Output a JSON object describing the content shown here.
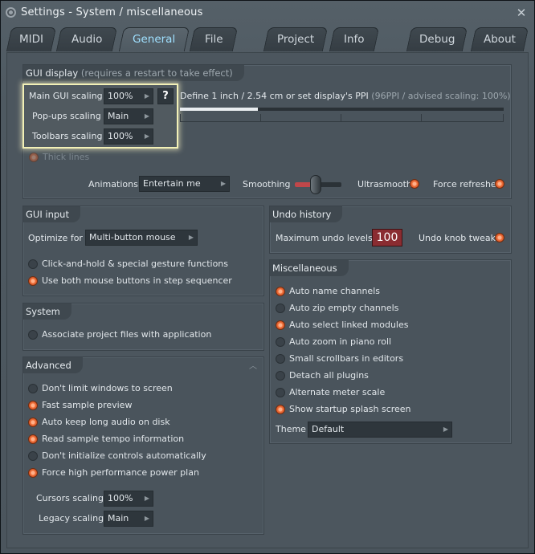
{
  "window": {
    "title": "Settings - System / miscellaneous",
    "close_glyph": "✕"
  },
  "tabs": [
    {
      "label": "MIDI"
    },
    {
      "label": "Audio"
    },
    {
      "label": "General",
      "active": true
    },
    {
      "label": "File"
    },
    {
      "label": "Project"
    },
    {
      "label": "Info"
    },
    {
      "label": "Debug"
    },
    {
      "label": "About"
    }
  ],
  "gui_display": {
    "title": "GUI display",
    "subtitle": "(requires a restart to take effect)",
    "main_scaling_label": "Main GUI scaling",
    "main_scaling_value": "100%",
    "help_label": "?",
    "popups_label": "Pop-ups scaling",
    "popups_value": "Main",
    "toolbars_label": "Toolbars scaling",
    "toolbars_value": "100%",
    "define_label": "Define 1 inch / 2.54 cm or set display's PPI",
    "define_hint": "(96PPI / advised scaling: 100%)",
    "ppi_level": 0.24,
    "thick_lines_label": "Thick lines",
    "animations_label": "Animations",
    "animations_value": "Entertain me",
    "smoothing_label": "Smoothing",
    "smoothing_level": 0.45,
    "ultrasmooth_label": "Ultrasmooth",
    "force_refreshes_label": "Force refreshes"
  },
  "gui_input": {
    "title": "GUI input",
    "optimize_label": "Optimize for",
    "optimize_value": "Multi-button mouse",
    "options": [
      {
        "label": "Click-and-hold & special gesture functions",
        "checked": false
      },
      {
        "label": "Use both mouse buttons in step sequencer",
        "checked": true
      }
    ]
  },
  "system": {
    "title": "System",
    "options": [
      {
        "label": "Associate project files with application",
        "checked": false
      }
    ]
  },
  "advanced": {
    "title": "Advanced",
    "collapse_glyph": "︿",
    "options": [
      {
        "label": "Don't limit windows to screen",
        "checked": false
      },
      {
        "label": "Fast sample preview",
        "checked": true
      },
      {
        "label": "Auto keep long audio on disk",
        "checked": true
      },
      {
        "label": "Read sample tempo information",
        "checked": true
      },
      {
        "label": "Don't initialize controls automatically",
        "checked": false
      },
      {
        "label": "Force high performance power plan",
        "checked": true
      }
    ],
    "cursors_label": "Cursors scaling",
    "cursors_value": "100%",
    "legacy_label": "Legacy scaling",
    "legacy_value": "Main"
  },
  "undo_history": {
    "title": "Undo history",
    "max_label": "Maximum undo levels",
    "max_value": "100",
    "knob_tweaks_label": "Undo knob tweaks"
  },
  "misc": {
    "title": "Miscellaneous",
    "options": [
      {
        "label": "Auto name channels",
        "checked": true
      },
      {
        "label": "Auto zip empty channels",
        "checked": false
      },
      {
        "label": "Auto select linked modules",
        "checked": true
      },
      {
        "label": "Auto zoom in piano roll",
        "checked": false
      },
      {
        "label": "Small scrollbars in editors",
        "checked": false
      },
      {
        "label": "Detach all plugins",
        "checked": false
      },
      {
        "label": "Alternate meter scale",
        "checked": false
      },
      {
        "label": "Show startup splash screen",
        "checked": true
      }
    ],
    "theme_label": "Theme",
    "theme_value": "Default"
  },
  "colors": {
    "accent_orange": "#f0703a",
    "undo_red": "#8a2c31",
    "active_tab_text": "#9fe0ff"
  },
  "dropdown_arrow": "▶"
}
